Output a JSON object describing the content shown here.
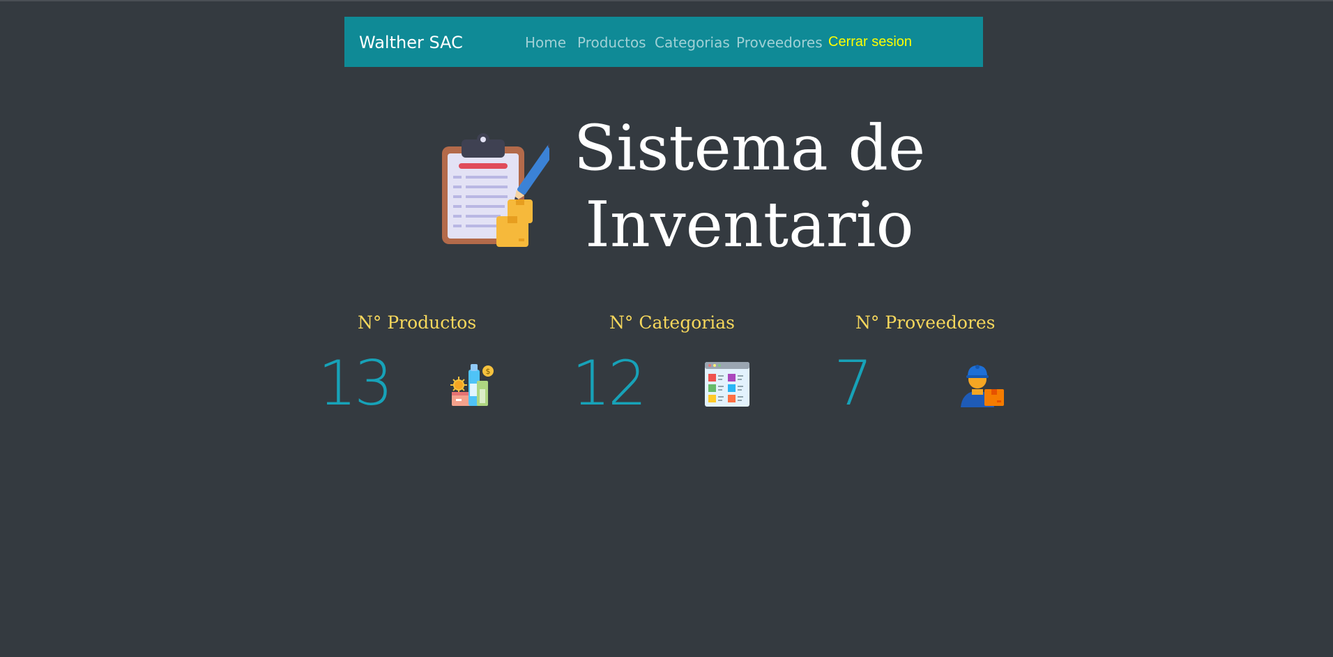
{
  "navbar": {
    "brand": "Walther SAC",
    "links": [
      "Home",
      "Productos",
      "Categorias",
      "Proveedores"
    ],
    "logout": "Cerrar sesion"
  },
  "hero": {
    "title_line1": "Sistema de",
    "title_line2": "Inventario",
    "icon": "clipboard-inventory-icon"
  },
  "stats": [
    {
      "label": "N° Productos",
      "value": "13",
      "icon": "products-icon"
    },
    {
      "label": "N° Categorias",
      "value": "12",
      "icon": "categories-grid-icon"
    },
    {
      "label": "N° Proveedores",
      "value": "7",
      "icon": "supplier-worker-icon"
    }
  ],
  "colors": {
    "background": "#343a40",
    "navbar": "#0f8a96",
    "logout": "#ffff00",
    "stat_label": "#f6d75c",
    "stat_value": "#17a2b8"
  }
}
